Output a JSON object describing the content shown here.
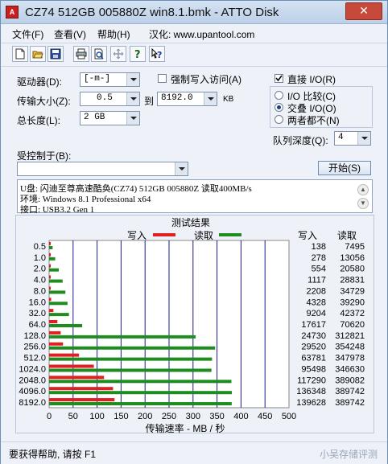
{
  "window": {
    "title": "CZ74 512GB 005880Z win8.1.bmk - ATTO Disk",
    "app_icon_text": "A",
    "close_label": "✕"
  },
  "menu": {
    "file": "文件(F)",
    "view": "查看(V)",
    "help": "帮助(H)",
    "localized_by": "汉化: www.upantool.com"
  },
  "toolbar": {
    "icons": [
      "new-icon",
      "open-icon",
      "save-icon",
      "print-icon",
      "print-preview-icon",
      "move-icon",
      "help-icon",
      "context-help-icon"
    ]
  },
  "settings": {
    "drive_label": "驱动器(D):",
    "drive_value": "[-m-]",
    "transfer_size_label": "传输大小(Z):",
    "transfer_from": "0.5",
    "to_label": "到",
    "transfer_to": "8192.0",
    "kb_label": "KB",
    "total_length_label": "总长度(L):",
    "total_length_value": "2 GB",
    "force_write_label": "强制写入访问(A)",
    "direct_io_label": "直接 I/O(R)",
    "io_compare_label": "I/O 比较(C)",
    "overlapped_io_label": "交叠 I/O(O)",
    "neither_label": "两者都不(N)",
    "queue_depth_label": "队列深度(Q):",
    "queue_depth_value": "4",
    "controlled_by_label": "受控制于(B):",
    "controlled_by_value": "",
    "start_button": "开始(S)"
  },
  "info": {
    "line1": "U盘: 闪迪至尊高速酷奂(CZ74) 512GB 005880Z 读取400MB/s",
    "line2": "环境: Windows 8.1 Professional x64",
    "line3": "接口: USB3.2 Gen 1"
  },
  "results": {
    "title": "测试结果",
    "legend_write": "写入",
    "legend_read": "读取",
    "col_write": "写入",
    "col_read": "读取",
    "colors": {
      "write": "#e02020",
      "read": "#1e8c1e",
      "gridline": "#1a1a8c"
    }
  },
  "chart_data": {
    "type": "bar",
    "orientation": "horizontal",
    "title": "测试结果",
    "xlabel": "传输速率 - MB / 秒",
    "xlim": [
      0,
      500
    ],
    "xticks": [
      "0",
      "50",
      "100",
      "150",
      "200",
      "250",
      "300",
      "350",
      "400",
      "450",
      "500"
    ],
    "categories": [
      "0.5",
      "1.0",
      "2.0",
      "4.0",
      "8.0",
      "16.0",
      "32.0",
      "64.0",
      "128.0",
      "256.0",
      "512.0",
      "1024.0",
      "2048.0",
      "4096.0",
      "8192.0"
    ],
    "series": [
      {
        "name": "写入",
        "values": [
          0.13,
          0.27,
          0.54,
          1.09,
          2.16,
          4.23,
          8.99,
          17.2,
          24.2,
          28.9,
          62.3,
          93.3,
          114.5,
          133.3,
          136.4
        ],
        "labels": [
          "138",
          "278",
          "554",
          "1117",
          "2208",
          "4328",
          "9204",
          "17617",
          "24730",
          "29520",
          "63781",
          "95498",
          "117290",
          "136348",
          "139628"
        ]
      },
      {
        "name": "读取",
        "values": [
          7.3,
          12.7,
          20.1,
          28.2,
          33.9,
          38.4,
          41.4,
          69.0,
          305.5,
          346.0,
          339.6,
          338.4,
          380.0,
          380.8,
          380.6
        ],
        "labels": [
          "7495",
          "13056",
          "20580",
          "28831",
          "34729",
          "39290",
          "42372",
          "70620",
          "312821",
          "354248",
          "347978",
          "346630",
          "389082",
          "389742",
          "389742"
        ]
      }
    ]
  },
  "status": {
    "help_text": "要获得帮助, 请按 F1",
    "watermark": "小吴存储评测"
  }
}
